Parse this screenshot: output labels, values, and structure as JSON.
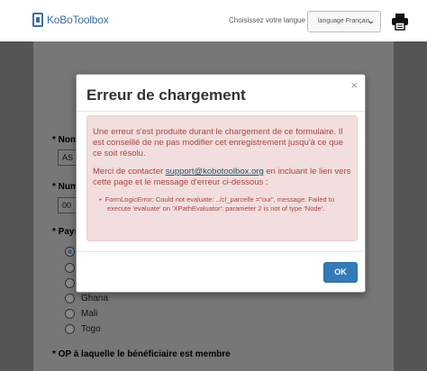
{
  "header": {
    "logo_text": "KoBoToolbox",
    "language_label": "Choisissez votre langue",
    "language_selected": "language Français"
  },
  "form": {
    "questions": [
      {
        "label": "Nom"
      },
      {
        "label": "Num"
      },
      {
        "label": "Pays"
      }
    ],
    "inputs": [
      "AS",
      "00"
    ],
    "radio_options": [
      {
        "label": "",
        "checked": true
      },
      {
        "label": "",
        "checked": false
      },
      {
        "label": "",
        "checked": false
      },
      {
        "label": "Ghana",
        "checked": false
      },
      {
        "label": "Mali",
        "checked": false
      },
      {
        "label": "Togo",
        "checked": false
      }
    ],
    "op_question": "OP à laquelle le bénéficiaire est membre"
  },
  "modal": {
    "title": "Erreur de chargement",
    "close_symbol": "×",
    "paragraph1": "Une erreur s'est produite durant le chargement de ce formulaire. Il est conseillé de ne pas modifier cet enregistrement jusqu'à ce que ce soit résolu.",
    "paragraph2_before": "Merci de contacter ",
    "support_email": "support@kobotoolbox.org",
    "paragraph2_after": " en incluant le lien vers cette page et le message d'erreur ci-dessous :",
    "error_item": "FormLogicError: Could not evaluate: ../cl_parcelle =\"oui\", message: Failed to execute 'evaluate' on 'XPathEvaluator': parameter 2 is not of type 'Node'.",
    "ok_label": "OK"
  },
  "colors": {
    "alert_bg": "#f2dede",
    "alert_text": "#a94442",
    "primary": "#337ab7"
  }
}
